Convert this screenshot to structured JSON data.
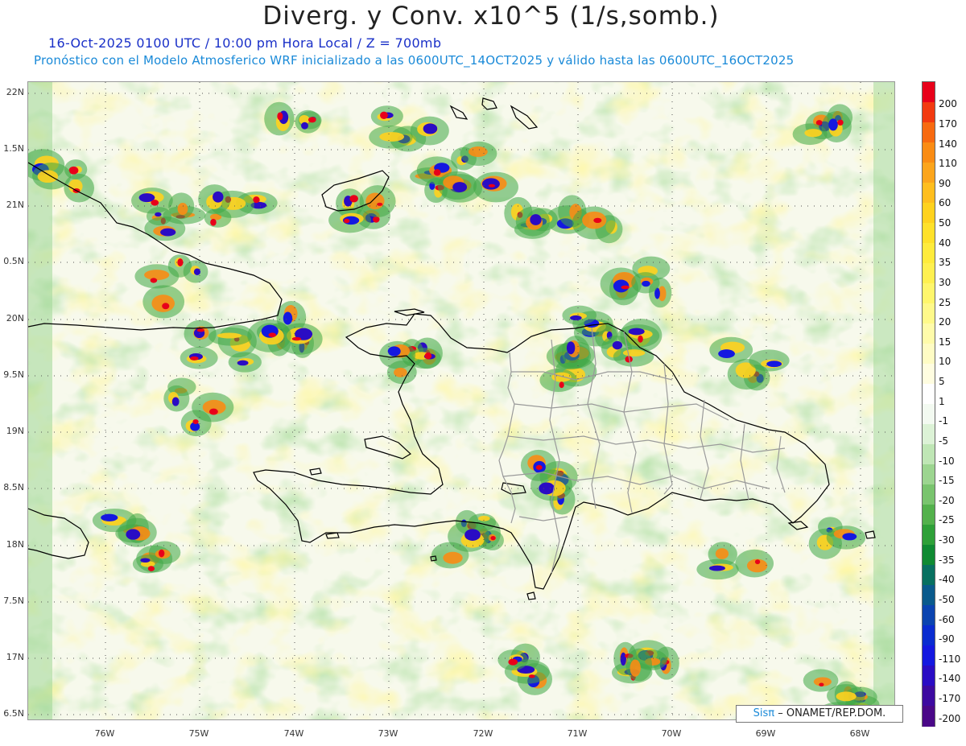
{
  "title": "Diverg. y Conv. x10^5 (1/s,somb.)",
  "subtitle_line1": "16-Oct-2025  0100 UTC / 10:00 pm Hora Local / Z = 700mb",
  "subtitle_line2": "Pronóstico con el Modelo Atmosferico WRF inicializado a las 0600UTC_14OCT2025 y válido hasta las  0600UTC_16OCT2025",
  "axes": {
    "lat_labels": [
      "22N",
      "1.5N",
      "21N",
      "0.5N",
      "20N",
      "9.5N",
      "19N",
      "8.5N",
      "18N",
      "7.5N",
      "17N",
      "6.5N"
    ],
    "lon_labels": [
      "76W",
      "75W",
      "74W",
      "73W",
      "72W",
      "71W",
      "70W",
      "69W",
      "68W"
    ]
  },
  "colorbar": {
    "labels": [
      "200",
      "170",
      "140",
      "110",
      "90",
      "60",
      "50",
      "40",
      "35",
      "30",
      "25",
      "20",
      "15",
      "10",
      "5",
      "1",
      "-1",
      "-5",
      "-10",
      "-15",
      "-20",
      "-25",
      "-30",
      "-35",
      "-40",
      "-50",
      "-60",
      "-90",
      "-110",
      "-140",
      "-170",
      "-200"
    ],
    "colors": [
      "#e8001a",
      "#f23a10",
      "#f76a10",
      "#fa8c14",
      "#fca51c",
      "#ffbe1e",
      "#ffd21e",
      "#ffe12a",
      "#ffeb3c",
      "#fff050",
      "#fff66c",
      "#fff98a",
      "#fffbaa",
      "#fffcc4",
      "#fffde0",
      "#ffffff",
      "#f3faf1",
      "#dcf2d6",
      "#bfe6b5",
      "#9cd590",
      "#79c46e",
      "#53b14c",
      "#2ea038",
      "#0f8a32",
      "#087060",
      "#0a5a8c",
      "#0b44b0",
      "#0a2cd0",
      "#1418e0",
      "#2a0cc4",
      "#3d0aa0",
      "#4a0888"
    ]
  },
  "credit": {
    "brand": "Sisπ",
    "text": "– ONAMET/REP.DOM."
  },
  "map_colors": {
    "ocean_base": "#fbfbe6",
    "coast": "#000000",
    "province_border": "#9a9a9a",
    "grid": "#555555"
  }
}
